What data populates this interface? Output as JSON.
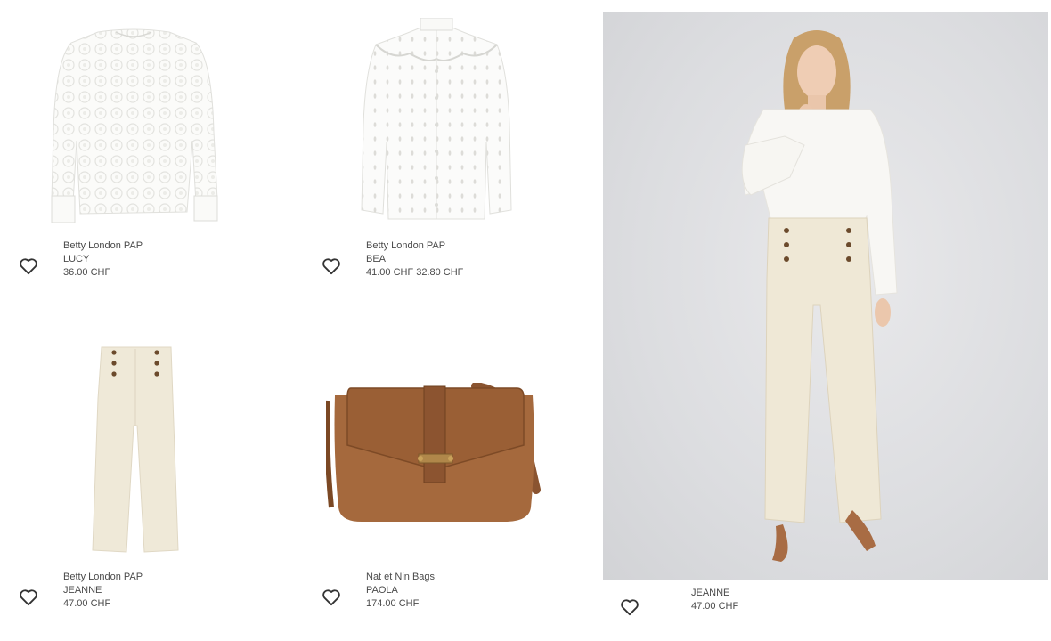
{
  "products": [
    {
      "brand": "Betty London PAP",
      "name": "LUCY",
      "price": "36.00 CHF",
      "old_price": ""
    },
    {
      "brand": "Betty London PAP",
      "name": "BEA",
      "price": "32.80 CHF",
      "old_price": "41.00 CHF"
    },
    {
      "brand": "Betty London PAP",
      "name": "JEANNE",
      "price": "47.00 CHF",
      "old_price": ""
    },
    {
      "brand": "Nat et Nin Bags",
      "name": "PAOLA",
      "price": "174.00 CHF",
      "old_price": ""
    }
  ],
  "featured": {
    "name": "JEANNE",
    "price": "47.00 CHF"
  },
  "icons": {
    "wishlist": "heart-outline-icon"
  },
  "colors": {
    "text": "#4a4a4a",
    "photo_bg": "#dcdde0",
    "cream": "#efe9d9",
    "leather": "#9a5f35"
  }
}
